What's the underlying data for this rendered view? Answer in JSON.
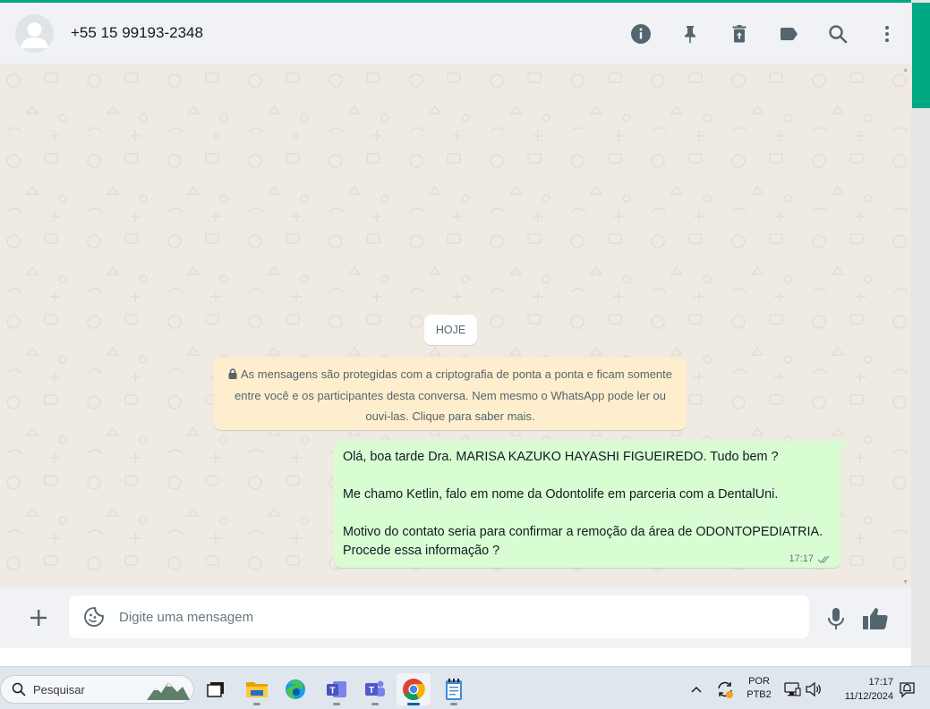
{
  "header": {
    "contact_name": "+55 15 99193-2348",
    "icons": [
      "info-icon",
      "pin-icon",
      "delete-icon",
      "label-icon",
      "search-icon",
      "menu-icon"
    ]
  },
  "chat": {
    "date_chip": "HOJE",
    "encryption_notice": "As mensagens são protegidas com a criptografia de ponta a ponta e ficam somente entre você e os participantes desta conversa. Nem mesmo o WhatsApp pode ler ou ouvi-las. Clique para saber mais.",
    "message": {
      "line1": "Olá, boa tarde Dra. MARISA KAZUKO HAYASHI FIGUEIREDO. Tudo bem ?",
      "line2": "Me chamo Ketlin, falo em nome da Odontolife em parceria com a DentalUni.",
      "line3": "Motivo do contato seria para confirmar a remoção da área de ODONTOPEDIATRIA. Procede essa informação ?",
      "time": "17:17",
      "status": "read"
    }
  },
  "composer": {
    "placeholder": "Digite uma mensagem"
  },
  "taskbar": {
    "search_label": "Pesquisar",
    "apps": [
      "task-view",
      "file-explorer",
      "edge",
      "teams-work",
      "teams",
      "chrome",
      "notepad"
    ],
    "active_app": "chrome",
    "lang_line1": "POR",
    "lang_line2": "PTB2",
    "time": "17:17",
    "date": "11/12/2024"
  },
  "colors": {
    "accent": "#00a884",
    "bubble_out": "#d9fdd3",
    "notice_bg": "#ffeecd",
    "header_bg": "#f0f2f5",
    "chat_bg": "#efeae2",
    "icon": "#54656f"
  }
}
